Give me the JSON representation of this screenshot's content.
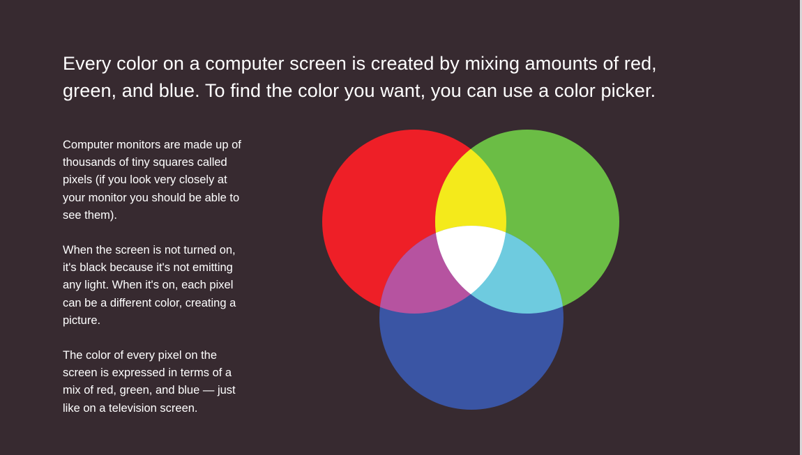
{
  "headline": "Every color on a computer screen is created by mixing amounts of red, green, and blue. To find the color you want, you can use a color picker.",
  "paragraphs": [
    "Computer monitors are made up of thousands of tiny squares called pixels (if you look very closely at your monitor you should be able to see them).",
    "When the screen is not turned on, it's black because it's not emitting any light. When it's on, each pixel can be a different color, creating a picture.",
    "The color of every pixel on the screen is expressed in terms of a mix of red, green, and blue — just like on a television screen."
  ],
  "colors": {
    "background": "#372a30",
    "red": "#ee1f27",
    "green": "#6bbd45",
    "blue": "#3a55a4",
    "yellow": "#f4ea1b",
    "magenta": "#b653a0",
    "cyan": "#6ecbdf",
    "white": "#ffffff"
  },
  "diagram_circles": [
    "red",
    "green",
    "blue"
  ]
}
